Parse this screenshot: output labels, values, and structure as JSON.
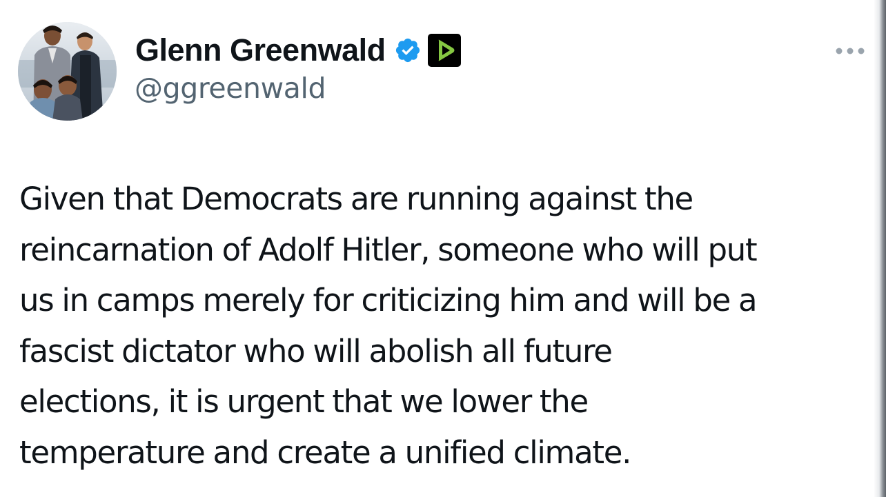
{
  "author": {
    "display_name": "Glenn Greenwald",
    "handle": "@ggreenwald",
    "avatar_icon": "profile-photo-avatar",
    "verified_icon": "verified-badge-icon",
    "affiliation_icon": "rumble-play-icon"
  },
  "more_icon": "more-options-icon",
  "tweet": {
    "lines": [
      "Given that Democrats are running against the",
      "reincarnation of Adolf Hitler, someone who will put",
      "us in camps merely for criticizing him and will be a",
      "fascist dictator who will abolish all future",
      "elections, it is urgent that we lower the",
      "temperature and create a unified climate."
    ]
  },
  "colors": {
    "text": "#0f1419",
    "secondary_text": "#536471",
    "verified_blue": "#1d9bf0",
    "rumble_green": "#85c742",
    "rumble_bg": "#000000"
  }
}
